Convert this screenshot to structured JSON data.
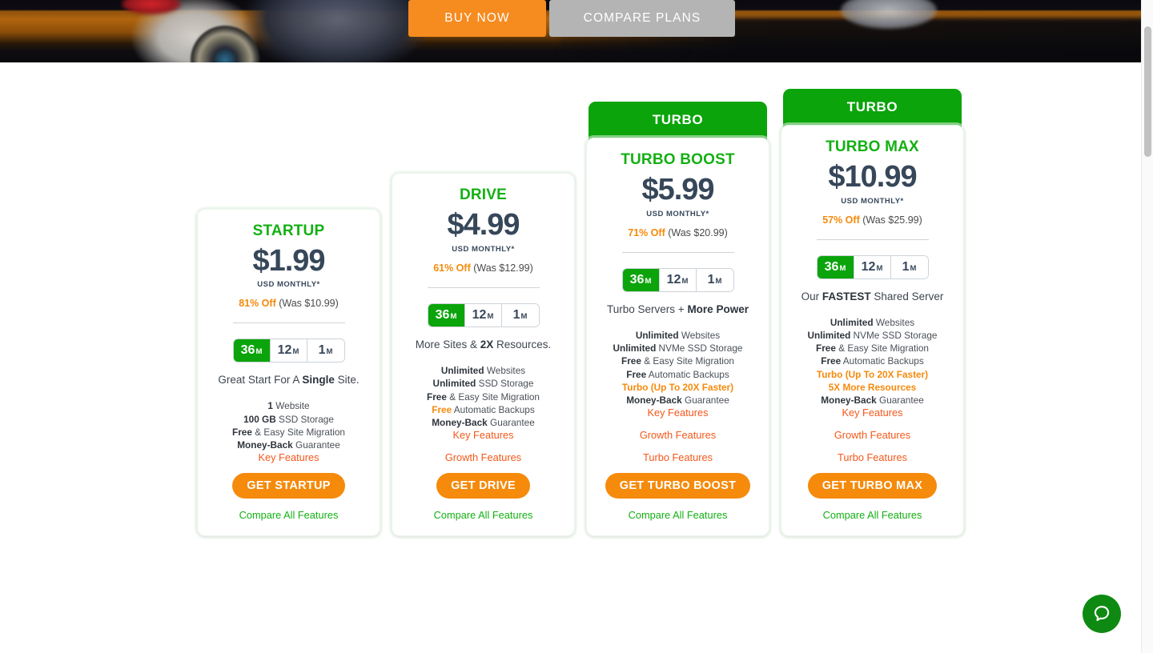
{
  "hero": {
    "buy_now_label": "BUY NOW",
    "compare_plans_label": "COMPARE PLANS"
  },
  "colors": {
    "brand_green": "#0BA40B",
    "plan_name_green": "#13B013",
    "accent_orange": "#F58A0B",
    "link_orange": "#F4581A",
    "cta_orange": "#F68B1F",
    "price_slate": "#37475A",
    "compare_gray": "#b4b4b4"
  },
  "terms": {
    "options": [
      {
        "value": "36",
        "unit": "M",
        "active": true
      },
      {
        "value": "12",
        "unit": "M",
        "active": false
      },
      {
        "value": "1",
        "unit": "M",
        "active": false
      }
    ]
  },
  "plans": [
    {
      "banner": null,
      "name": "STARTUP",
      "price": "$1.99",
      "price_unit": "USD MONTHLY*",
      "discount_pct": "81% Off",
      "discount_was": "(Was $10.99)",
      "tagline_parts": [
        {
          "text": "Great Start For A ",
          "bold": false
        },
        {
          "text": "Single",
          "bold": true
        },
        {
          "text": " Site.",
          "bold": false
        }
      ],
      "features": [
        {
          "bold": "1",
          "rest": " Website",
          "style": "normal"
        },
        {
          "bold": "100 GB",
          "rest": " SSD Storage",
          "style": "normal"
        },
        {
          "bold": "Free",
          "rest": " & Easy Site Migration",
          "style": "normal"
        },
        {
          "bold": "Money-Back",
          "rest": " Guarantee",
          "style": "normal"
        }
      ],
      "feature_links": [
        "Key Features"
      ],
      "cta_label": "GET STARTUP",
      "compare_label": "Compare All Features"
    },
    {
      "banner": null,
      "name": "DRIVE",
      "price": "$4.99",
      "price_unit": "USD MONTHLY*",
      "discount_pct": "61% Off",
      "discount_was": "(Was $12.99)",
      "tagline_parts": [
        {
          "text": "More Sites & ",
          "bold": false
        },
        {
          "text": "2X",
          "bold": true
        },
        {
          "text": " Resources.",
          "bold": false
        }
      ],
      "features": [
        {
          "bold": "Unlimited",
          "rest": " Websites",
          "style": "normal"
        },
        {
          "bold": "Unlimited",
          "rest": " SSD Storage",
          "style": "normal"
        },
        {
          "bold": "Free",
          "rest": " & Easy Site Migration",
          "style": "normal"
        },
        {
          "bold": "Free",
          "rest": " Automatic Backups",
          "style": "orange-bold"
        },
        {
          "bold": "Money-Back",
          "rest": " Guarantee",
          "style": "normal"
        }
      ],
      "feature_links": [
        "Key Features",
        "Growth Features"
      ],
      "cta_label": "GET DRIVE",
      "compare_label": "Compare All Features"
    },
    {
      "banner": "TURBO",
      "name": "TURBO BOOST",
      "price": "$5.99",
      "price_unit": "USD MONTHLY*",
      "discount_pct": "71% Off",
      "discount_was": "(Was $20.99)",
      "tagline_parts": [
        {
          "text": "Turbo Servers + ",
          "bold": false
        },
        {
          "text": "More Power",
          "bold": true
        }
      ],
      "features": [
        {
          "bold": "Unlimited",
          "rest": " Websites",
          "style": "normal"
        },
        {
          "bold": "Unlimited",
          "rest": " NVMe SSD Storage",
          "style": "normal"
        },
        {
          "bold": "Free",
          "rest": " & Easy Site Migration",
          "style": "normal"
        },
        {
          "bold": "Free",
          "rest": " Automatic Backups",
          "style": "normal"
        },
        {
          "bold": "Turbo (Up To 20X Faster)",
          "rest": "",
          "style": "all-orange"
        },
        {
          "bold": "Money-Back",
          "rest": " Guarantee",
          "style": "normal"
        }
      ],
      "feature_links": [
        "Key Features",
        "Growth Features",
        "Turbo Features"
      ],
      "cta_label": "GET TURBO BOOST",
      "compare_label": "Compare All Features"
    },
    {
      "banner": "TURBO",
      "name": "TURBO MAX",
      "price": "$10.99",
      "price_unit": "USD MONTHLY*",
      "discount_pct": "57% Off",
      "discount_was": "(Was $25.99)",
      "tagline_parts": [
        {
          "text": "Our ",
          "bold": false
        },
        {
          "text": "FASTEST",
          "bold": true
        },
        {
          "text": " Shared Server",
          "bold": false
        }
      ],
      "features": [
        {
          "bold": "Unlimited",
          "rest": " Websites",
          "style": "normal"
        },
        {
          "bold": "Unlimited",
          "rest": " NVMe SSD Storage",
          "style": "normal"
        },
        {
          "bold": "Free",
          "rest": " & Easy Site Migration",
          "style": "normal"
        },
        {
          "bold": "Free",
          "rest": " Automatic Backups",
          "style": "normal"
        },
        {
          "bold": "Turbo (Up To 20X Faster)",
          "rest": "",
          "style": "all-orange"
        },
        {
          "bold": "5X More Resources",
          "rest": "",
          "style": "all-orange"
        },
        {
          "bold": "Money-Back",
          "rest": " Guarantee",
          "style": "normal"
        }
      ],
      "feature_links": [
        "Key Features",
        "Growth Features",
        "Turbo Features"
      ],
      "cta_label": "GET TURBO MAX",
      "compare_label": "Compare All Features"
    }
  ],
  "chat_widget": {
    "icon": "chat-bubble-icon"
  },
  "scrollbar": {
    "orientation": "vertical"
  }
}
